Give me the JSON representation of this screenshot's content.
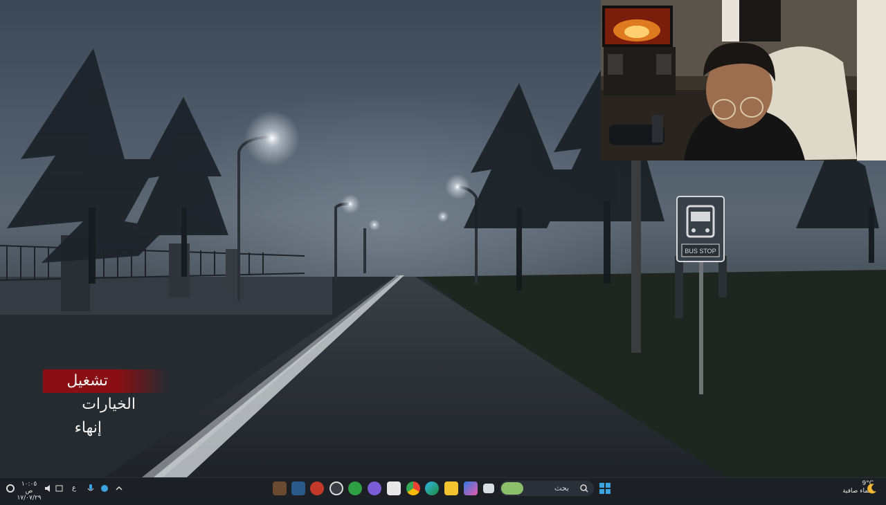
{
  "game": {
    "menu": [
      {
        "label": "تشغيل",
        "selected": true
      },
      {
        "label": "الخيارات",
        "selected": false
      },
      {
        "label": "إنهاء",
        "selected": false
      }
    ],
    "bus_stop_sign": "BUS STOP",
    "accent_color": "#8a0f14"
  },
  "taskbar": {
    "search_placeholder": "بحث",
    "weather_temp": "9°C",
    "weather_desc": "سماء صافية",
    "clock_time": "١٠:٠٥ ص",
    "clock_date": "١٧/٠٧/٢٩",
    "language": "ع",
    "pinned_icons": [
      "game-thumbnail-icon",
      "steam-icon",
      "chrome-canary-icon",
      "media-player-icon",
      "xbox-icon",
      "discord-icon",
      "store-icon",
      "chrome-icon",
      "edge-icon",
      "file-explorer-icon",
      "copilot-icon",
      "window-icon"
    ],
    "tray_icons": [
      "chevron-up-icon",
      "network-icon",
      "mic-icon",
      "language-indicator",
      "wifi-icon",
      "speaker-icon",
      "battery-icon",
      "settings-icon"
    ]
  }
}
